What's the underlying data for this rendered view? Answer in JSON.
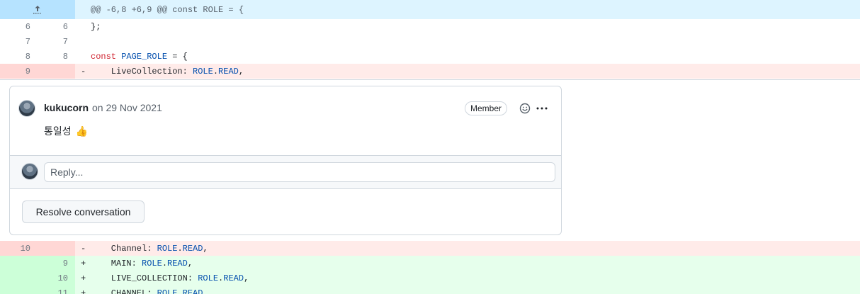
{
  "hunk": {
    "expand_icon": "expand-up-icon",
    "header": "@@ -6,8 +6,9 @@ const ROLE = {"
  },
  "lines_before": [
    {
      "old": "6",
      "new": "6",
      "sign": "",
      "code": "};",
      "type": "context"
    },
    {
      "old": "7",
      "new": "7",
      "sign": "",
      "code": "",
      "type": "context"
    },
    {
      "old": "8",
      "new": "8",
      "sign": "",
      "code_kw": "const",
      "code_id": "PAGE_ROLE",
      "code_rest": " = {",
      "type": "context"
    },
    {
      "old": "9",
      "new": "",
      "sign": "-",
      "code_pre": "    LiveCollection: ",
      "code_id": "ROLE",
      "code_rest": ".",
      "code_id2": "READ",
      "code_end": ",",
      "type": "del"
    }
  ],
  "thread": {
    "comment": {
      "author": "kukucorn",
      "meta": "on 29 Nov 2021",
      "badge": "Member",
      "body": "통일성",
      "emoji": "👍",
      "react_icon": "smiley-icon",
      "more_icon": "kebab-horizontal-icon"
    },
    "reply_placeholder": "Reply...",
    "resolve_label": "Resolve conversation"
  },
  "lines_after": [
    {
      "old": "10",
      "new": "",
      "sign": "-",
      "pre": "    Channel: ",
      "obj": "ROLE",
      "prop": "READ",
      "end": ",",
      "type": "del"
    },
    {
      "old": "",
      "new": "9",
      "sign": "+",
      "pre": "    MAIN: ",
      "obj": "ROLE",
      "prop": "READ",
      "end": ",",
      "type": "add"
    },
    {
      "old": "",
      "new": "10",
      "sign": "+",
      "pre": "    LIVE_COLLECTION: ",
      "obj": "ROLE",
      "prop": "READ",
      "end": ",",
      "type": "add"
    },
    {
      "old": "",
      "new": "11",
      "sign": "+",
      "pre": "    CHANNEL: ",
      "obj": "ROLE",
      "prop": "READ",
      "end": "",
      "type": "add"
    }
  ],
  "colors": {
    "hunk_bg": "#ddf4ff",
    "del_bg": "#ffebe9",
    "add_bg": "#e6ffec",
    "keyword": "#cf222e",
    "identifier": "#0550ae"
  }
}
